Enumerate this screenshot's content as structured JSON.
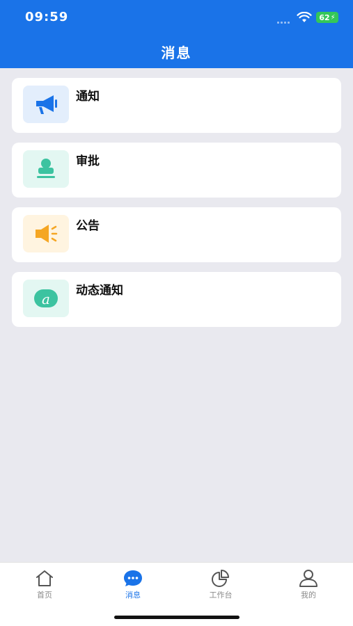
{
  "status_bar": {
    "time": "09:59",
    "battery": "62",
    "battery_color": "#34c759"
  },
  "header": {
    "title": "消息",
    "background": "#1a73e8"
  },
  "messages": [
    {
      "label": "通知",
      "icon": "megaphone-icon",
      "icon_bg": "#e3eefc",
      "icon_color": "#1a73e8"
    },
    {
      "label": "审批",
      "icon": "stamp-icon",
      "icon_bg": "#e3f7f2",
      "icon_color": "#3cc3a0"
    },
    {
      "label": "公告",
      "icon": "speaker-icon",
      "icon_bg": "#fff4e0",
      "icon_color": "#f5a623"
    },
    {
      "label": "动态通知",
      "icon": "at-icon",
      "icon_bg": "#e3f7f2",
      "icon_color": "#3cc3a0"
    }
  ],
  "tabbar": {
    "active_color": "#1a73e8",
    "items": [
      {
        "label": "首页",
        "icon": "home-icon"
      },
      {
        "label": "消息",
        "icon": "chat-bubble-icon"
      },
      {
        "label": "工作台",
        "icon": "pie-chart-icon"
      },
      {
        "label": "我的",
        "icon": "person-icon"
      }
    ]
  }
}
